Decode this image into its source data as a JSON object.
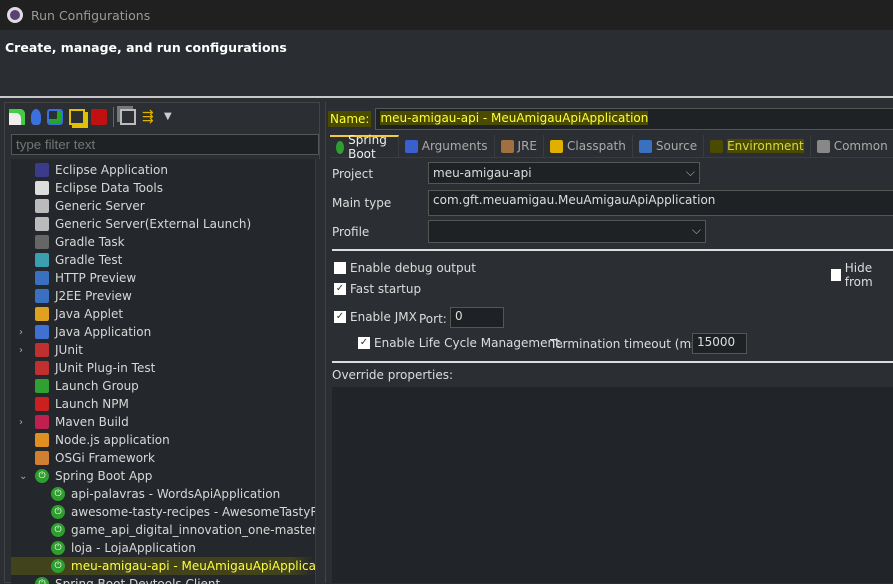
{
  "window": {
    "title": "Run Configurations",
    "icon": "gear-icon"
  },
  "header": {
    "title": "Create, manage, and run configurations"
  },
  "toolbar": {
    "icons": [
      "new-config-icon",
      "new-prototype-icon",
      "export-icon",
      "duplicate-icon",
      "delete-icon",
      "collapse-all-icon",
      "filter-icon",
      "dropdown-arrow-icon"
    ]
  },
  "filter": {
    "placeholder": "type filter text",
    "value": ""
  },
  "tree": [
    {
      "label": "Eclipse Application",
      "icon": "eclipse-icon",
      "color": "#3b3b8a"
    },
    {
      "label": "Eclipse Data Tools",
      "icon": "database-icon",
      "color": "#dddddd"
    },
    {
      "label": "Generic Server",
      "icon": "server-icon",
      "color": "#bbbbbb"
    },
    {
      "label": "Generic Server(External Launch)",
      "icon": "server-icon",
      "color": "#bbbbbb"
    },
    {
      "label": "Gradle Task",
      "icon": "gradle-icon",
      "color": "#666666"
    },
    {
      "label": "Gradle Test",
      "icon": "gradle-icon",
      "color": "#3aa0b0"
    },
    {
      "label": "HTTP Preview",
      "icon": "http-preview-icon",
      "color": "#3a70c0"
    },
    {
      "label": "J2EE Preview",
      "icon": "j2ee-preview-icon",
      "color": "#3a70c0"
    },
    {
      "label": "Java Applet",
      "icon": "java-applet-icon",
      "color": "#e0a020"
    },
    {
      "label": "Java Application",
      "icon": "java-app-icon",
      "color": "#4070d0",
      "expandable": true
    },
    {
      "label": "JUnit",
      "icon": "junit-icon",
      "color": "#c03030",
      "expandable": true
    },
    {
      "label": "JUnit Plug-in Test",
      "icon": "junit-plugin-icon",
      "color": "#c03030"
    },
    {
      "label": "Launch Group",
      "icon": "launch-group-icon",
      "color": "#30a030"
    },
    {
      "label": "Launch NPM",
      "icon": "npm-icon",
      "color": "#cc2020"
    },
    {
      "label": "Maven Build",
      "icon": "maven-icon",
      "color": "#c02050",
      "expandable": true
    },
    {
      "label": "Node.js application",
      "icon": "nodejs-icon",
      "color": "#e09020"
    },
    {
      "label": "OSGi Framework",
      "icon": "osgi-icon",
      "color": "#d08030"
    },
    {
      "label": "Spring Boot App",
      "icon": "spring-boot-icon",
      "color": "#2e9e2e",
      "expanded": true,
      "children": [
        {
          "label": "api-palavras - WordsApiApplication"
        },
        {
          "label": "awesome-tasty-recipes - AwesomeTastyRecipesApplication"
        },
        {
          "label": "game_api_digital_innovation_one-master - GameApiApplication"
        },
        {
          "label": "loja - LojaApplication"
        },
        {
          "label": "meu-amigau-api - MeuAmigauApiApplication",
          "selected": true
        }
      ]
    },
    {
      "label": "Spring Boot Devtools Client",
      "icon": "spring-devtools-icon",
      "color": "#2e9e2e"
    }
  ],
  "config": {
    "name_label": "Name:",
    "name_value": "meu-amigau-api - MeuAmigauApiApplication",
    "tabs": [
      {
        "label": "Spring Boot",
        "icon": "spring-boot-icon",
        "active": true
      },
      {
        "label": "Arguments",
        "icon": "arguments-icon"
      },
      {
        "label": "JRE",
        "icon": "jre-icon"
      },
      {
        "label": "Classpath",
        "icon": "classpath-icon"
      },
      {
        "label": "Source",
        "icon": "source-icon"
      },
      {
        "label": "Environment",
        "icon": "environment-icon"
      },
      {
        "label": "Common",
        "icon": "common-icon"
      }
    ],
    "project_label": "Project",
    "project_value": "meu-amigau-api",
    "main_type_label": "Main type",
    "main_type_value": "com.gft.meuamigau.MeuAmigauApiApplication",
    "profile_label": "Profile",
    "profile_value": "",
    "debug_label": "Enable debug output",
    "debug_checked": false,
    "hide_label": "Hide from",
    "hide_checked": false,
    "fast_label": "Fast startup",
    "fast_checked": true,
    "jmx_label": "Enable JMX",
    "jmx_checked": true,
    "port_label": "Port:",
    "port_value": "0",
    "lifecycle_label": "Enable Life Cycle Management.",
    "lifecycle_checked": true,
    "timeout_label": "Termination timeout (ms):",
    "timeout_value": "15000",
    "override_label": "Override properties:"
  }
}
